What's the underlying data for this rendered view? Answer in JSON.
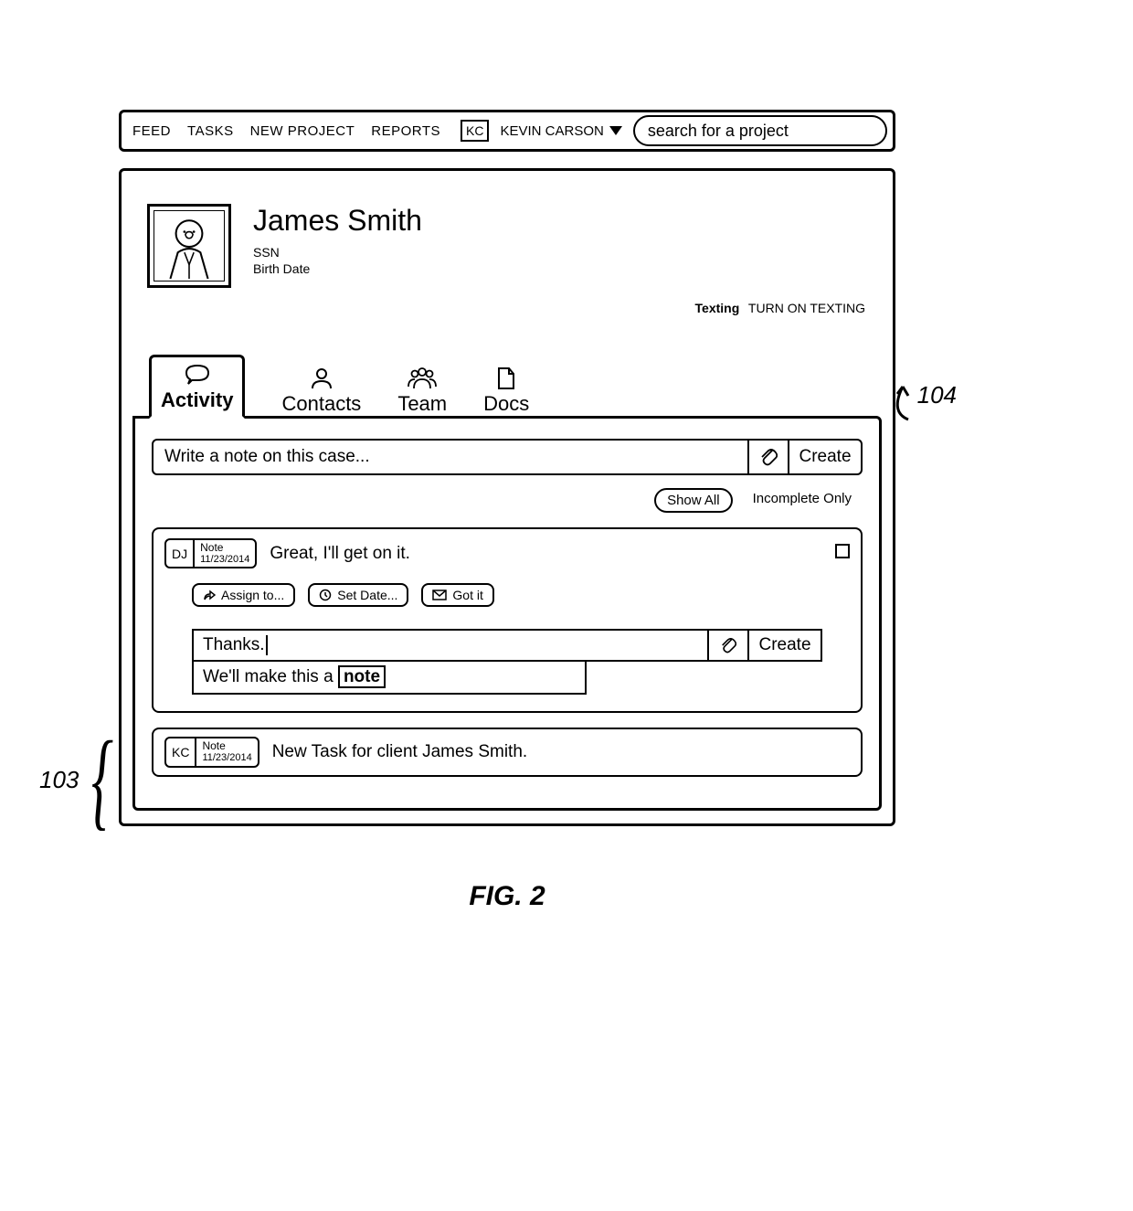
{
  "nav": {
    "feed": "FEED",
    "tasks": "TASKS",
    "new_project": "NEW PROJECT",
    "reports": "REPORTS",
    "user_initials": "KC",
    "user_name": "KEVIN CARSON",
    "search_placeholder": "search for a project"
  },
  "profile": {
    "name": "James Smith",
    "field1": "SSN",
    "field2": "Birth Date"
  },
  "texting": {
    "label": "Texting",
    "action": "TURN ON TEXTING"
  },
  "tabs": {
    "activity": "Activity",
    "contacts": "Contacts",
    "team": "Team",
    "docs": "Docs"
  },
  "compose": {
    "placeholder": "Write a note on this case...",
    "create": "Create"
  },
  "filters": {
    "show_all": "Show All",
    "incomplete": "Incomplete Only"
  },
  "feed": [
    {
      "who": "DJ",
      "type": "Note",
      "date": "11/23/2014",
      "text": "Great, I'll get on it."
    },
    {
      "who": "KC",
      "type": "Note",
      "date": "11/23/2014",
      "text": "New Task for client James Smith."
    }
  ],
  "actions": {
    "assign": "Assign to...",
    "set_date": "Set Date...",
    "got_it": "Got it"
  },
  "reply": {
    "text": "Thanks.",
    "create": "Create",
    "suggest_prefix": "We'll make this a ",
    "suggest_box": "note"
  },
  "callouts": {
    "c103": "103",
    "c104": "104"
  },
  "figure": "FIG. 2"
}
